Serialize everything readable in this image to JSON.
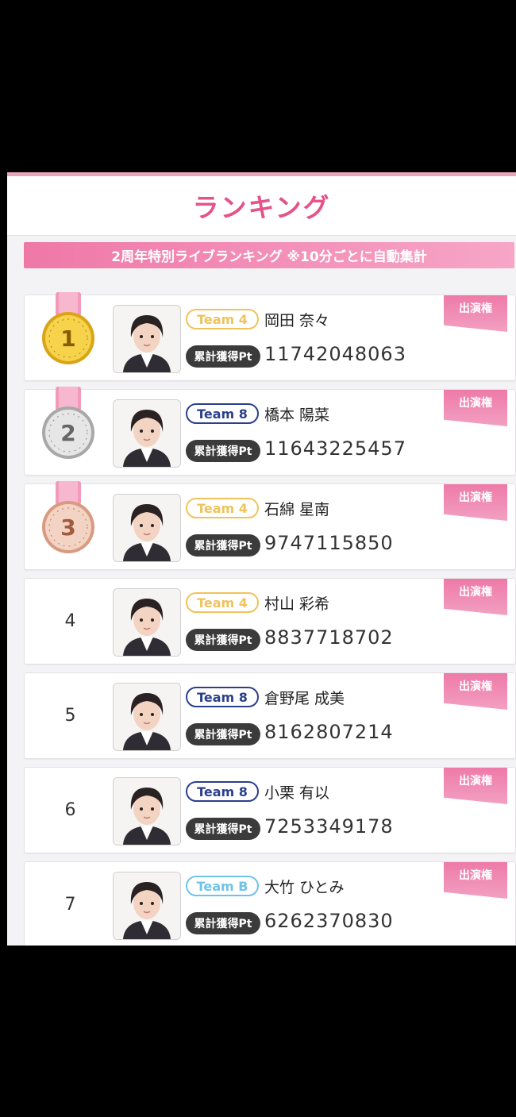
{
  "header": {
    "title": "ランキング"
  },
  "banner": {
    "text": "2周年特別ライブランキング ※10分ごとに自動集計"
  },
  "labels": {
    "pt_badge": "累計獲得Pt",
    "flag": "出演権"
  },
  "colors": {
    "accent": "#e4538b",
    "team4": "#f0c35a",
    "team8": "#2b3f8c",
    "teamB": "#6ec3ea"
  },
  "rankings": [
    {
      "rank": "1",
      "medal": "gold",
      "team": "Team 4",
      "team_key": "team4",
      "name": "岡田 奈々",
      "points": "11742048063"
    },
    {
      "rank": "2",
      "medal": "silver",
      "team": "Team 8",
      "team_key": "team8",
      "name": "橋本 陽菜",
      "points": "11643225457"
    },
    {
      "rank": "3",
      "medal": "bronze",
      "team": "Team 4",
      "team_key": "team4",
      "name": "石綿 星南",
      "points": "9747115850"
    },
    {
      "rank": "4",
      "medal": "",
      "team": "Team 4",
      "team_key": "team4",
      "name": "村山 彩希",
      "points": "8837718702"
    },
    {
      "rank": "5",
      "medal": "",
      "team": "Team 8",
      "team_key": "team8",
      "name": "倉野尾 成美",
      "points": "8162807214"
    },
    {
      "rank": "6",
      "medal": "",
      "team": "Team 8",
      "team_key": "team8",
      "name": "小栗 有以",
      "points": "7253349178"
    },
    {
      "rank": "7",
      "medal": "",
      "team": "Team B",
      "team_key": "teamB",
      "name": "大竹 ひとみ",
      "points": "6262370830"
    }
  ]
}
